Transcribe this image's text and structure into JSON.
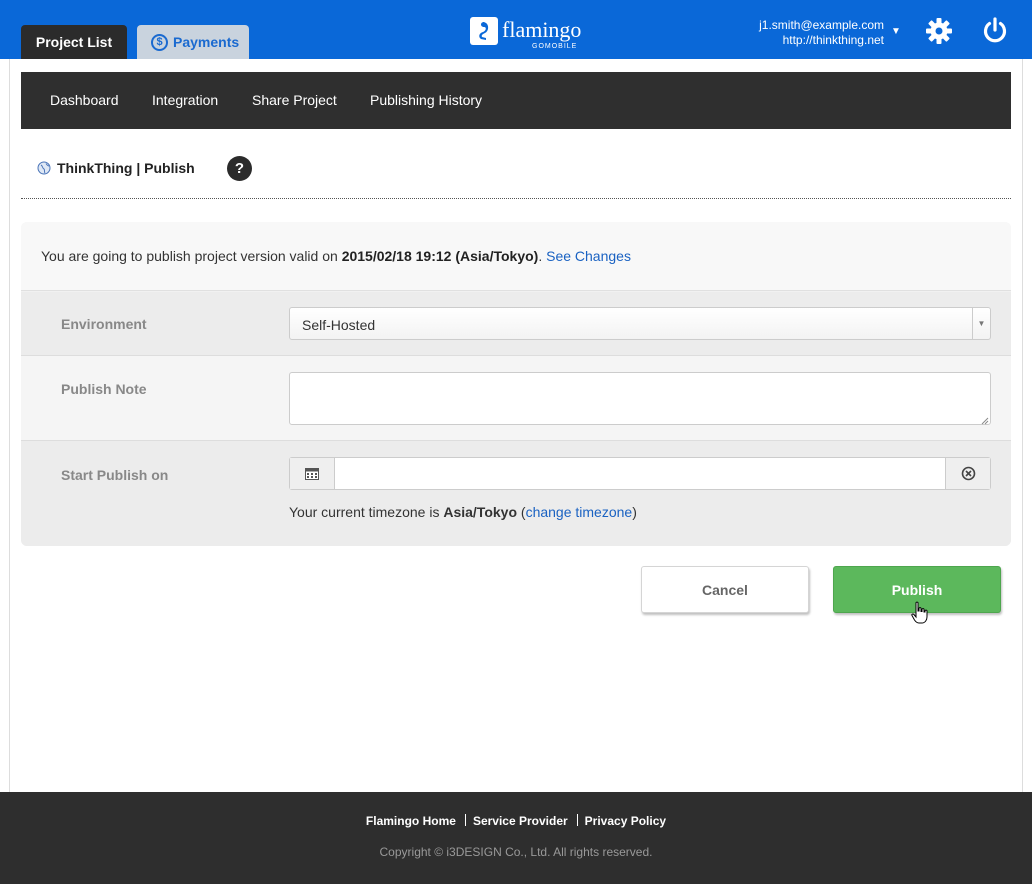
{
  "header": {
    "tabs": [
      {
        "label": "Project List",
        "active": true
      },
      {
        "label": "Payments",
        "active": false,
        "icon": "dollar-circle-icon"
      }
    ],
    "logo": {
      "name": "flamingo",
      "sub": "GOMOBILE"
    },
    "account": {
      "email": "j1.smith@example.com",
      "site": "http://thinkthing.net"
    },
    "icons": [
      "chevron-down-icon",
      "gear-icon",
      "power-icon"
    ]
  },
  "subnav": {
    "items": [
      "Dashboard",
      "Integration",
      "Share Project",
      "Publishing History"
    ]
  },
  "breadcrumb": {
    "text": "ThinkThing | Publish",
    "help_label": "?"
  },
  "publish_form": {
    "intro_prefix": "You are going to publish project version valid on",
    "intro_datetime": "2015/02/18 19:12 (Asia/Tokyo)",
    "intro_suffix": ".",
    "see_changes_label": "See Changes",
    "environment": {
      "label": "Environment",
      "value": "Self-Hosted"
    },
    "publish_note": {
      "label": "Publish Note",
      "value": ""
    },
    "start_publish": {
      "label": "Start Publish on",
      "value": ""
    },
    "timezone_prefix": "Your current timezone is",
    "timezone": "Asia/Tokyo",
    "change_timezone_label": "change timezone"
  },
  "actions": {
    "cancel_label": "Cancel",
    "publish_label": "Publish"
  },
  "footer": {
    "links": [
      "Flamingo Home",
      "Service Provider",
      "Privacy Policy"
    ],
    "copyright": "Copyright © i3DESIGN Co., Ltd. All rights reserved."
  },
  "colors": {
    "header_blue": "#0a68d8",
    "dark_nav": "#2f2f2f",
    "publish_green": "#5cb85c",
    "link_blue": "#1a62c2"
  }
}
